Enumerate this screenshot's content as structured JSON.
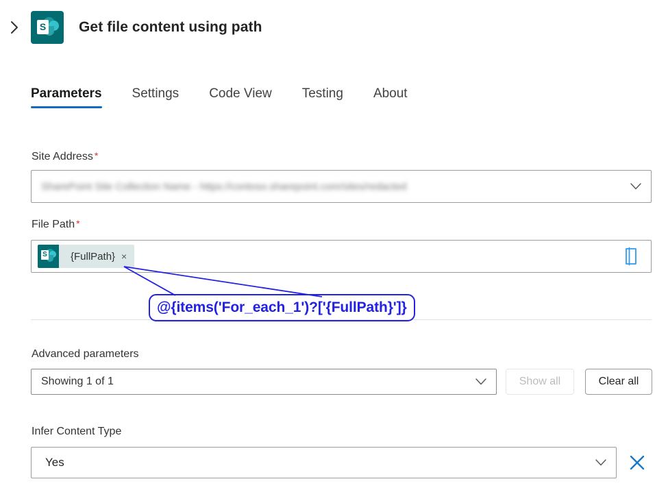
{
  "header": {
    "collapse_icon": "chevron-right-icon",
    "app_icon": "sharepoint-icon",
    "title": "Get file content using path"
  },
  "tabs": [
    {
      "label": "Parameters",
      "active": true
    },
    {
      "label": "Settings",
      "active": false
    },
    {
      "label": "Code View",
      "active": false
    },
    {
      "label": "Testing",
      "active": false
    },
    {
      "label": "About",
      "active": false
    }
  ],
  "fields": {
    "site_address": {
      "label": "Site Address",
      "required_marker": "*",
      "value": "SharePoint Site Collection Name - https://contoso.sharepoint.com/sites/redacted",
      "redacted": true,
      "dropdown_icon": "chevron-down-icon"
    },
    "file_path": {
      "label": "File Path",
      "required_marker": "*",
      "token": {
        "icon": "sharepoint-icon",
        "text": "{FullPath}",
        "remove_label": "×"
      },
      "picker_icon": "file-picker-icon"
    }
  },
  "advanced": {
    "label": "Advanced parameters",
    "select_value": "Showing 1 of 1",
    "dropdown_icon": "chevron-down-icon",
    "show_all_label": "Show all",
    "clear_all_label": "Clear all"
  },
  "infer_content_type": {
    "label": "Infer Content Type",
    "value": "Yes",
    "dropdown_icon": "chevron-down-icon",
    "delete_icon": "close-icon"
  },
  "annotation": {
    "text": "@{items('For_each_1')?['{FullPath}']}",
    "color": "#2222E2"
  },
  "colors": {
    "accent_blue": "#0F6CBD",
    "sharepoint_teal": "#036C70",
    "required_red": "#D13438",
    "annotation_blue": "#2222E2",
    "delete_blue": "#0F6CBD",
    "chip_background": "#DCE8E7"
  }
}
